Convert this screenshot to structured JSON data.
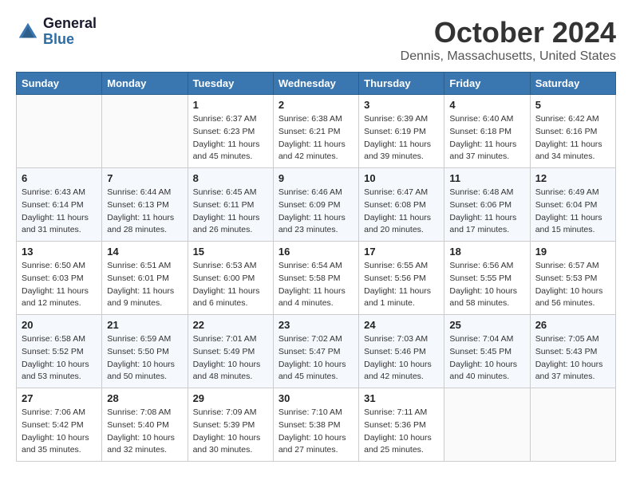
{
  "header": {
    "logo_line1": "General",
    "logo_line2": "Blue",
    "month": "October 2024",
    "location": "Dennis, Massachusetts, United States"
  },
  "weekdays": [
    "Sunday",
    "Monday",
    "Tuesday",
    "Wednesday",
    "Thursday",
    "Friday",
    "Saturday"
  ],
  "weeks": [
    [
      {
        "day": "",
        "info": ""
      },
      {
        "day": "",
        "info": ""
      },
      {
        "day": "1",
        "info": "Sunrise: 6:37 AM\nSunset: 6:23 PM\nDaylight: 11 hours\nand 45 minutes."
      },
      {
        "day": "2",
        "info": "Sunrise: 6:38 AM\nSunset: 6:21 PM\nDaylight: 11 hours\nand 42 minutes."
      },
      {
        "day": "3",
        "info": "Sunrise: 6:39 AM\nSunset: 6:19 PM\nDaylight: 11 hours\nand 39 minutes."
      },
      {
        "day": "4",
        "info": "Sunrise: 6:40 AM\nSunset: 6:18 PM\nDaylight: 11 hours\nand 37 minutes."
      },
      {
        "day": "5",
        "info": "Sunrise: 6:42 AM\nSunset: 6:16 PM\nDaylight: 11 hours\nand 34 minutes."
      }
    ],
    [
      {
        "day": "6",
        "info": "Sunrise: 6:43 AM\nSunset: 6:14 PM\nDaylight: 11 hours\nand 31 minutes."
      },
      {
        "day": "7",
        "info": "Sunrise: 6:44 AM\nSunset: 6:13 PM\nDaylight: 11 hours\nand 28 minutes."
      },
      {
        "day": "8",
        "info": "Sunrise: 6:45 AM\nSunset: 6:11 PM\nDaylight: 11 hours\nand 26 minutes."
      },
      {
        "day": "9",
        "info": "Sunrise: 6:46 AM\nSunset: 6:09 PM\nDaylight: 11 hours\nand 23 minutes."
      },
      {
        "day": "10",
        "info": "Sunrise: 6:47 AM\nSunset: 6:08 PM\nDaylight: 11 hours\nand 20 minutes."
      },
      {
        "day": "11",
        "info": "Sunrise: 6:48 AM\nSunset: 6:06 PM\nDaylight: 11 hours\nand 17 minutes."
      },
      {
        "day": "12",
        "info": "Sunrise: 6:49 AM\nSunset: 6:04 PM\nDaylight: 11 hours\nand 15 minutes."
      }
    ],
    [
      {
        "day": "13",
        "info": "Sunrise: 6:50 AM\nSunset: 6:03 PM\nDaylight: 11 hours\nand 12 minutes."
      },
      {
        "day": "14",
        "info": "Sunrise: 6:51 AM\nSunset: 6:01 PM\nDaylight: 11 hours\nand 9 minutes."
      },
      {
        "day": "15",
        "info": "Sunrise: 6:53 AM\nSunset: 6:00 PM\nDaylight: 11 hours\nand 6 minutes."
      },
      {
        "day": "16",
        "info": "Sunrise: 6:54 AM\nSunset: 5:58 PM\nDaylight: 11 hours\nand 4 minutes."
      },
      {
        "day": "17",
        "info": "Sunrise: 6:55 AM\nSunset: 5:56 PM\nDaylight: 11 hours\nand 1 minute."
      },
      {
        "day": "18",
        "info": "Sunrise: 6:56 AM\nSunset: 5:55 PM\nDaylight: 10 hours\nand 58 minutes."
      },
      {
        "day": "19",
        "info": "Sunrise: 6:57 AM\nSunset: 5:53 PM\nDaylight: 10 hours\nand 56 minutes."
      }
    ],
    [
      {
        "day": "20",
        "info": "Sunrise: 6:58 AM\nSunset: 5:52 PM\nDaylight: 10 hours\nand 53 minutes."
      },
      {
        "day": "21",
        "info": "Sunrise: 6:59 AM\nSunset: 5:50 PM\nDaylight: 10 hours\nand 50 minutes."
      },
      {
        "day": "22",
        "info": "Sunrise: 7:01 AM\nSunset: 5:49 PM\nDaylight: 10 hours\nand 48 minutes."
      },
      {
        "day": "23",
        "info": "Sunrise: 7:02 AM\nSunset: 5:47 PM\nDaylight: 10 hours\nand 45 minutes."
      },
      {
        "day": "24",
        "info": "Sunrise: 7:03 AM\nSunset: 5:46 PM\nDaylight: 10 hours\nand 42 minutes."
      },
      {
        "day": "25",
        "info": "Sunrise: 7:04 AM\nSunset: 5:45 PM\nDaylight: 10 hours\nand 40 minutes."
      },
      {
        "day": "26",
        "info": "Sunrise: 7:05 AM\nSunset: 5:43 PM\nDaylight: 10 hours\nand 37 minutes."
      }
    ],
    [
      {
        "day": "27",
        "info": "Sunrise: 7:06 AM\nSunset: 5:42 PM\nDaylight: 10 hours\nand 35 minutes."
      },
      {
        "day": "28",
        "info": "Sunrise: 7:08 AM\nSunset: 5:40 PM\nDaylight: 10 hours\nand 32 minutes."
      },
      {
        "day": "29",
        "info": "Sunrise: 7:09 AM\nSunset: 5:39 PM\nDaylight: 10 hours\nand 30 minutes."
      },
      {
        "day": "30",
        "info": "Sunrise: 7:10 AM\nSunset: 5:38 PM\nDaylight: 10 hours\nand 27 minutes."
      },
      {
        "day": "31",
        "info": "Sunrise: 7:11 AM\nSunset: 5:36 PM\nDaylight: 10 hours\nand 25 minutes."
      },
      {
        "day": "",
        "info": ""
      },
      {
        "day": "",
        "info": ""
      }
    ]
  ]
}
